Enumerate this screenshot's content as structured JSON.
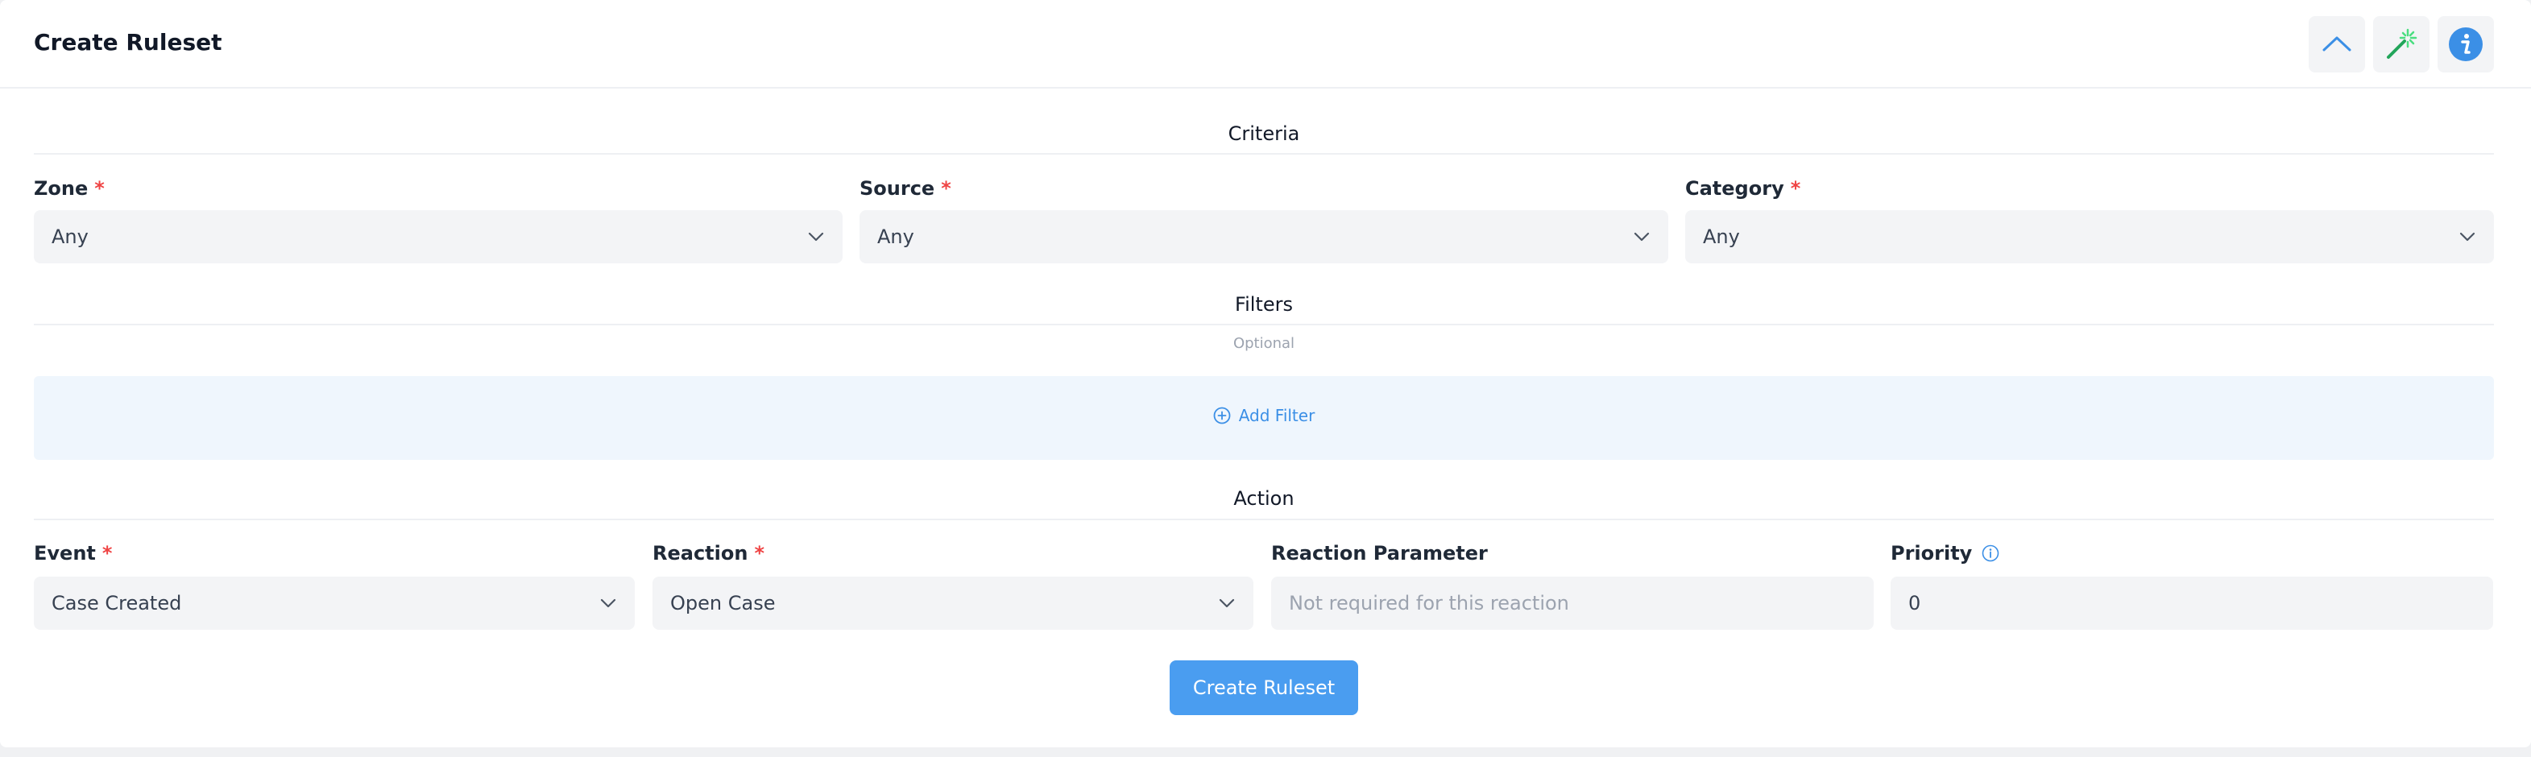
{
  "header": {
    "title": "Create Ruleset",
    "icons": [
      "chevron-up-icon",
      "magic-wand-icon",
      "info-icon"
    ]
  },
  "criteria": {
    "title": "Criteria",
    "zone": {
      "label": "Zone",
      "value": "Any"
    },
    "source": {
      "label": "Source",
      "value": "Any"
    },
    "category": {
      "label": "Category",
      "value": "Any"
    }
  },
  "filters": {
    "title": "Filters",
    "optional": "Optional",
    "add_label": "Add Filter"
  },
  "action": {
    "title": "Action",
    "event": {
      "label": "Event",
      "value": "Case Created"
    },
    "reaction": {
      "label": "Reaction",
      "value": "Open Case"
    },
    "reaction_parameter": {
      "label": "Reaction Parameter",
      "placeholder": "Not required for this reaction"
    },
    "priority": {
      "label": "Priority",
      "value": "0"
    }
  },
  "submit_label": "Create Ruleset",
  "colors": {
    "accent": "#4a9df0",
    "required": "#ef4444",
    "field_bg": "#f3f4f6",
    "filter_bg": "#eff6fd"
  }
}
